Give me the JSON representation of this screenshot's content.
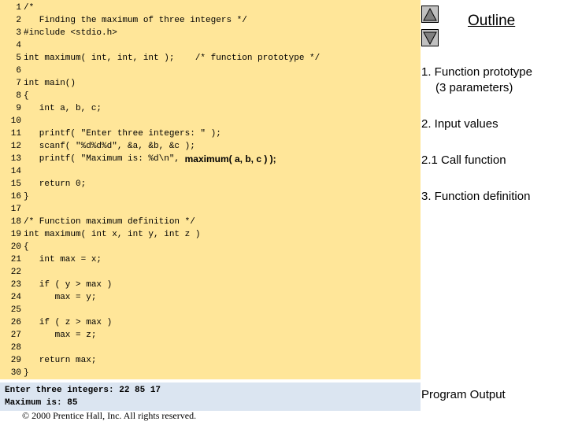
{
  "code": {
    "lines": [
      {
        "num": "1",
        "text": "/*"
      },
      {
        "num": "2",
        "text": "   Finding the maximum of three integers */"
      },
      {
        "num": "3",
        "text": "#include <stdio.h>"
      },
      {
        "num": "4",
        "text": ""
      },
      {
        "num": "5",
        "text": "int maximum( int, int, int );    /* function prototype */"
      },
      {
        "num": "6",
        "text": ""
      },
      {
        "num": "7",
        "text": "int main()"
      },
      {
        "num": "8",
        "text": "{"
      },
      {
        "num": "9",
        "text": "   int a, b, c;"
      },
      {
        "num": "10",
        "text": ""
      },
      {
        "num": "11",
        "text": "   printf( \"Enter three integers: \" );"
      },
      {
        "num": "12",
        "text": "   scanf( \"%d%d%d\", &a, &b, &c );"
      },
      {
        "num": "13",
        "text": "   printf( \"Maximum is: %d\\n\", "
      },
      {
        "num": "14",
        "text": ""
      },
      {
        "num": "15",
        "text": "   return 0;"
      },
      {
        "num": "16",
        "text": "}"
      },
      {
        "num": "17",
        "text": ""
      },
      {
        "num": "18",
        "text": "/* Function maximum definition */"
      },
      {
        "num": "19",
        "text": "int maximum( int x, int y, int z )"
      },
      {
        "num": "20",
        "text": "{"
      },
      {
        "num": "21",
        "text": "   int max = x;"
      },
      {
        "num": "22",
        "text": ""
      },
      {
        "num": "23",
        "text": "   if ( y > max )"
      },
      {
        "num": "24",
        "text": "      max = y;"
      },
      {
        "num": "25",
        "text": ""
      },
      {
        "num": "26",
        "text": "   if ( z > max )"
      },
      {
        "num": "27",
        "text": "      max = z;"
      },
      {
        "num": "28",
        "text": ""
      },
      {
        "num": "29",
        "text": "   return max;"
      },
      {
        "num": "30",
        "text": "}"
      }
    ],
    "line13_call": "maximum( a, b, c ) );"
  },
  "output": {
    "lines": [
      "Enter three integers: 22 85 17",
      "Maximum is: 85"
    ]
  },
  "copyright": "© 2000 Prentice Hall, Inc.  All rights reserved.",
  "outline": {
    "title": "Outline",
    "items": [
      {
        "line1": "1.  Function prototype",
        "line2": "(3 parameters)"
      },
      {
        "line1": "2.  Input values",
        "line2": ""
      },
      {
        "line1": "2.1  Call function",
        "line2": ""
      },
      {
        "line1": "3. Function definition",
        "line2": ""
      }
    ]
  },
  "program_output_label": "Program Output",
  "icons": {
    "prev": "triangle-up-icon",
    "next": "triangle-down-icon"
  },
  "colors": {
    "code_bg": "#ffe699",
    "output_bg": "#dbe5f1",
    "button_bg": "#c0c0c0"
  }
}
